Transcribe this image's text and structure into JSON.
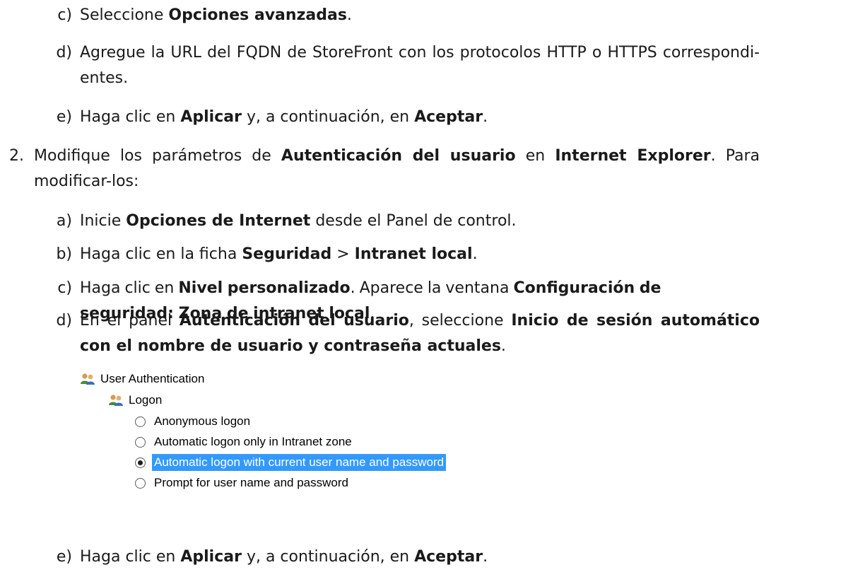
{
  "steps": [
    {
      "marker": "c)",
      "parts": [
        {
          "t": "Seleccione "
        },
        {
          "t": "Opciones avanzadas",
          "b": true
        },
        {
          "t": "."
        }
      ]
    },
    {
      "marker": "d)",
      "parts": [
        {
          "t": "Agregue la URL del FQDN de StoreFront con los protocolos HTTP o HTTPS correspondi-entes."
        }
      ]
    },
    {
      "marker": "e)",
      "parts": [
        {
          "t": "Haga clic en "
        },
        {
          "t": "Aplicar",
          "b": true
        },
        {
          "t": " y, a continuación, en "
        },
        {
          "t": "Aceptar",
          "b": true
        },
        {
          "t": "."
        }
      ]
    },
    {
      "marker": "2.",
      "parts": [
        {
          "t": "Modifique los parámetros de "
        },
        {
          "t": "Autenticación del usuario",
          "b": true
        },
        {
          "t": " en "
        },
        {
          "t": "Internet Explorer",
          "b": true
        },
        {
          "t": ". Para modificar-los:"
        }
      ]
    },
    {
      "marker": "a)",
      "parts": [
        {
          "t": "Inicie "
        },
        {
          "t": "Opciones de Internet",
          "b": true
        },
        {
          "t": " desde el Panel de control."
        }
      ]
    },
    {
      "marker": "b)",
      "parts": [
        {
          "t": "Haga clic en la ficha "
        },
        {
          "t": "Seguridad",
          "b": true
        },
        {
          "t": " > "
        },
        {
          "t": "Intranet local",
          "b": true
        },
        {
          "t": "."
        }
      ]
    },
    {
      "marker": "c)",
      "parts": [
        {
          "t": "Haga clic en "
        },
        {
          "t": "Nivel personalizado",
          "b": true
        },
        {
          "t": ". Aparece la ventana "
        },
        {
          "t": "Configuración de seguridad: Zona de intranet local",
          "b": true
        },
        {
          "t": "."
        }
      ]
    },
    {
      "marker": "d)",
      "parts": [
        {
          "t": "En el panel "
        },
        {
          "t": "Autenticación del usuario",
          "b": true
        },
        {
          "t": ", seleccione "
        },
        {
          "t": "Inicio de sesión automático con el nombre de usuario y contraseña actuales",
          "b": true
        },
        {
          "t": "."
        }
      ]
    },
    {
      "marker": "e)",
      "parts": [
        {
          "t": "Haga clic en "
        },
        {
          "t": "Aplicar",
          "b": true
        },
        {
          "t": " y, a continuación, en "
        },
        {
          "t": "Aceptar",
          "b": true
        },
        {
          "t": "."
        }
      ]
    }
  ],
  "screenshot": {
    "root_label": "User Authentication",
    "group_label": "Logon",
    "options": [
      {
        "label": "Anonymous logon",
        "selected": false
      },
      {
        "label": "Automatic logon only in Intranet zone",
        "selected": false
      },
      {
        "label": "Automatic logon with current user name and password",
        "selected": true
      },
      {
        "label": "Prompt for user name and password",
        "selected": false
      }
    ],
    "selection_color": "#3399ff",
    "icon": "users-icon"
  }
}
